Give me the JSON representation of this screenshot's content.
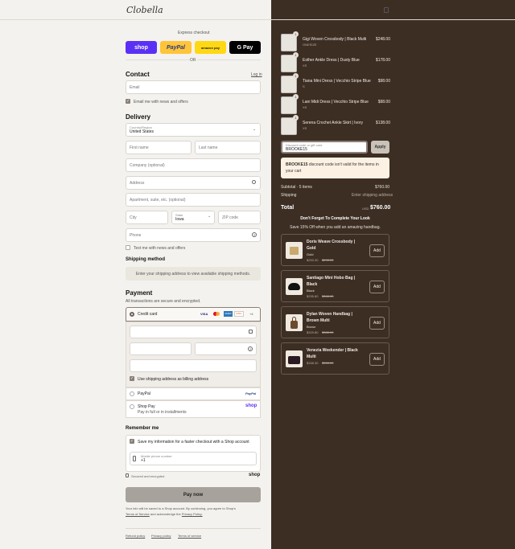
{
  "brand": "Clobella",
  "express": {
    "title": "Express checkout",
    "shop": "shop",
    "paypal": "PayPal",
    "amazon": "amazon pay",
    "gpay": "G Pay",
    "or": "OR"
  },
  "contact": {
    "title": "Contact",
    "login": "Log in",
    "email_ph": "Email",
    "news": "Email me with news and offers"
  },
  "delivery": {
    "title": "Delivery",
    "country_label": "Country/Region",
    "country": "United States",
    "first": "First name",
    "last": "Last name",
    "company": "Company (optional)",
    "address": "Address",
    "apt": "Apartment, suite, etc. (optional)",
    "city": "City",
    "state_label": "State",
    "state": "Iowa",
    "zip": "ZIP code",
    "phone": "Phone",
    "text_news": "Text me with news and offers"
  },
  "shipping_method": {
    "title": "Shipping method",
    "note": "Enter your shipping address to view available shipping methods."
  },
  "payment": {
    "title": "Payment",
    "secure": "All transactions are secure and encrypted.",
    "credit": "Credit card",
    "cards": [
      "VISA",
      "MC",
      "AMEX",
      "DISC",
      "+4"
    ],
    "billing": "Use shipping address as billing address",
    "paypal": "PayPal",
    "paypal_logo": "PayPal",
    "shoppay": "Shop Pay",
    "shoppay_sub": "Pay in full or in installments",
    "shoppay_logo": "shop"
  },
  "remember": {
    "title": "Remember me",
    "save": "Save my information for a faster checkout with a Shop account",
    "mobile_label": "Mobile phone number",
    "mobile": "+1",
    "secured": "Secured and encrypted",
    "shop": "shop"
  },
  "pay_now": "Pay now",
  "legal": {
    "line1": "Your info will be saved to a Shop account. By continuing, you agree to Shop's",
    "tos": "Terms of Service",
    "and": "and acknowledge the",
    "privacy": "Privacy Policy."
  },
  "footer": [
    "Refund policy",
    "Privacy policy",
    "Terms of service"
  ],
  "cart": [
    {
      "qty": "1",
      "name": "Gigi Woven Crossbody | Black Multi",
      "variant": "ONESIZE",
      "price": "$248.00"
    },
    {
      "qty": "1",
      "name": "Esther Ankle Dress | Dusty Blue",
      "variant": "XS",
      "price": "$178.00"
    },
    {
      "qty": "1",
      "name": "Tiana Mini Dress | Vecchio Stripe Blue",
      "variant": "S",
      "price": "$98.00"
    },
    {
      "qty": "1",
      "name": "Lani Midi Dress | Vecchio Stripe Blue",
      "variant": "XS",
      "price": "$98.00"
    },
    {
      "qty": "1",
      "name": "Serena Crochet Ankle Skirt | Ivory",
      "variant": "XS",
      "price": "$138.00"
    }
  ],
  "discount": {
    "label": "Discount code or gift card",
    "value": "BROOKE15",
    "apply": "Apply",
    "error_code": "BROOKE15",
    "error_text": "discount code isn't valid for the items in your cart"
  },
  "totals": {
    "subtotal_label": "Subtotal · 5 items",
    "subtotal": "$760.00",
    "shipping_label": "Shipping",
    "shipping": "Enter shipping address",
    "total_label": "Total",
    "currency": "USD",
    "total": "$760.00"
  },
  "upsell": {
    "title": "Don't Forget To Complete Your Look",
    "sub": "Save 15% Off when you add an amazing handbag.",
    "add": "Add",
    "items": [
      {
        "name": "Doris Weave Crossbody | Gold",
        "variant": "Gold",
        "price": "$253.30",
        "old": "$298.00"
      },
      {
        "name": "Santiago Mini Hobo Bag | Black",
        "variant": "Black",
        "price": "$295.80",
        "old": "$348.00"
      },
      {
        "name": "Dylan Woven Handbag | Brown Multi",
        "variant": "Brown",
        "price": "$329.80",
        "old": "$388.00"
      },
      {
        "name": "Venezia Weekender | Black Multi",
        "variant": "",
        "price": "$338.30",
        "old": "$398.00"
      }
    ]
  },
  "colors": {
    "left_bg": "#f4f2ee",
    "right_bg": "#3d2e24",
    "shop": "#5a31f4",
    "paypal": "#ffc439",
    "amazon": "#ffd814",
    "gpay": "#000000",
    "pay_btn": "#a8a29c"
  }
}
